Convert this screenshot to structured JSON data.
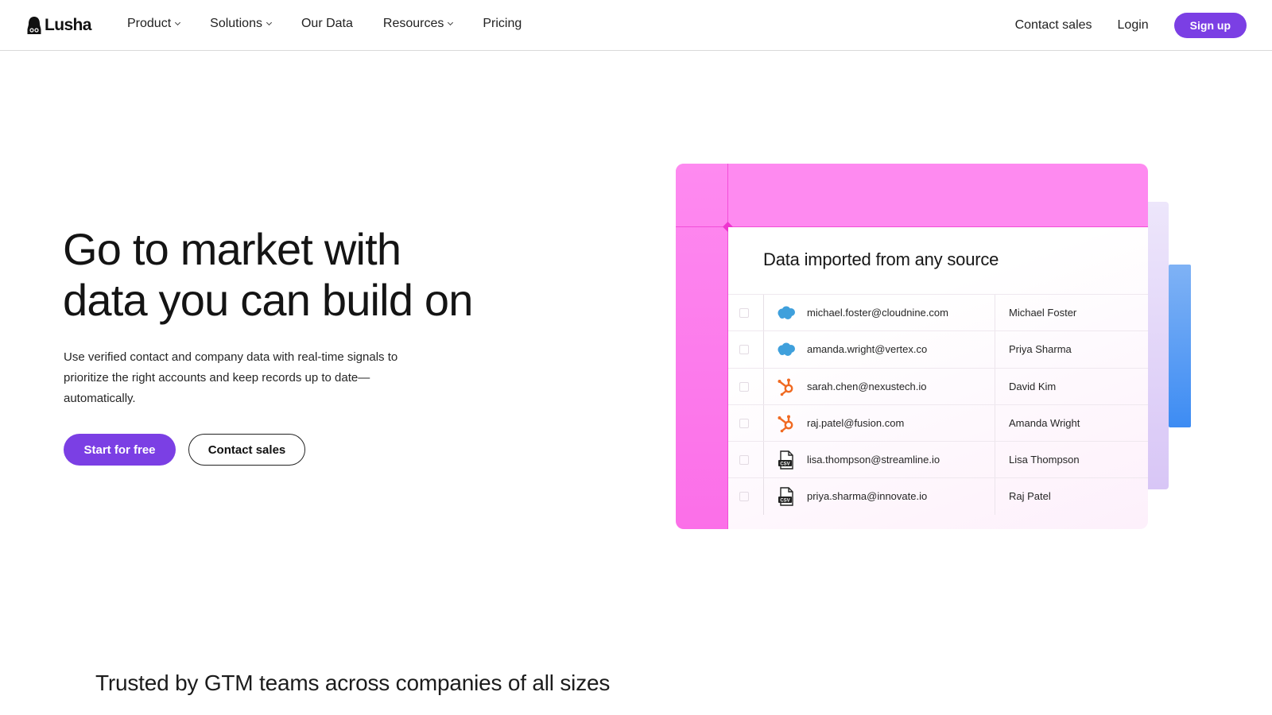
{
  "brand": {
    "name": "Lusha",
    "accent": "#7b3fe4"
  },
  "nav": {
    "links": [
      {
        "label": "Product",
        "has_dropdown": true
      },
      {
        "label": "Solutions",
        "has_dropdown": true
      },
      {
        "label": "Our Data",
        "has_dropdown": false
      },
      {
        "label": "Resources",
        "has_dropdown": true
      },
      {
        "label": "Pricing",
        "has_dropdown": false
      }
    ],
    "contact_sales": "Contact sales",
    "login": "Login",
    "signup": "Sign up"
  },
  "hero": {
    "title_line1": "Go to market with",
    "title_line2": "data you can build on",
    "subtitle": "Use verified contact and company data with real-time signals to prioritize the right accounts and keep records up to date—automatically.",
    "cta_primary": "Start for free",
    "cta_secondary": "Contact sales"
  },
  "illustration": {
    "title": "Data imported from any source",
    "rows": [
      {
        "source_icon": "salesforce-icon",
        "email": "michael.foster@cloudnine.com",
        "name": "Michael Foster"
      },
      {
        "source_icon": "salesforce-icon",
        "email": "amanda.wright@vertex.co",
        "name": "Priya Sharma"
      },
      {
        "source_icon": "hubspot-icon",
        "email": "sarah.chen@nexustech.io",
        "name": "David Kim"
      },
      {
        "source_icon": "hubspot-icon",
        "email": "raj.patel@fusion.com",
        "name": "Amanda Wright"
      },
      {
        "source_icon": "csv-file-icon",
        "email": "lisa.thompson@streamline.io",
        "name": "Lisa Thompson"
      },
      {
        "source_icon": "csv-file-icon",
        "email": "priya.sharma@innovate.io",
        "name": "Raj Patel"
      }
    ],
    "csv_label": "CSV",
    "colors": {
      "pink": "#fe8af0",
      "blue": "#3d8cf3",
      "lavender": "#d8c6f6",
      "salesforce": "#3fa0dc",
      "hubspot": "#f06a22"
    }
  },
  "trusted": {
    "heading": "Trusted by GTM teams across companies of all sizes"
  }
}
